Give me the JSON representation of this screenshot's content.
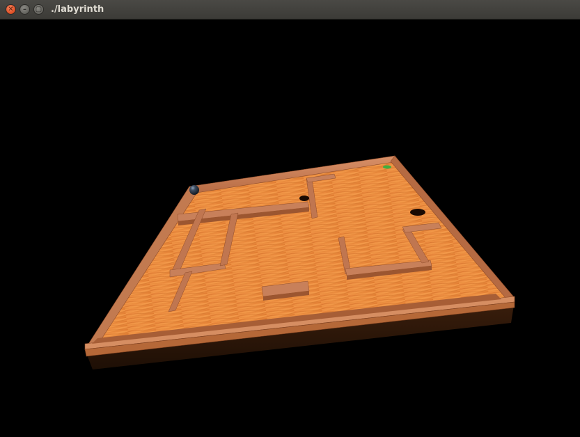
{
  "window": {
    "title": "./labyrinth",
    "buttons": {
      "close_glyph": "✕",
      "minimize_glyph": "–",
      "maximize_glyph": "▢"
    }
  },
  "scene": {
    "background_color": "#000000",
    "board_material": "wood",
    "wood_light_color": "#f08a3c",
    "wood_dark_color": "#b5541a",
    "wall_color": "#c47a4e",
    "ball_color": "#2e3a48",
    "goal_marker_color": "#3fae3f",
    "hole_count": 2
  }
}
